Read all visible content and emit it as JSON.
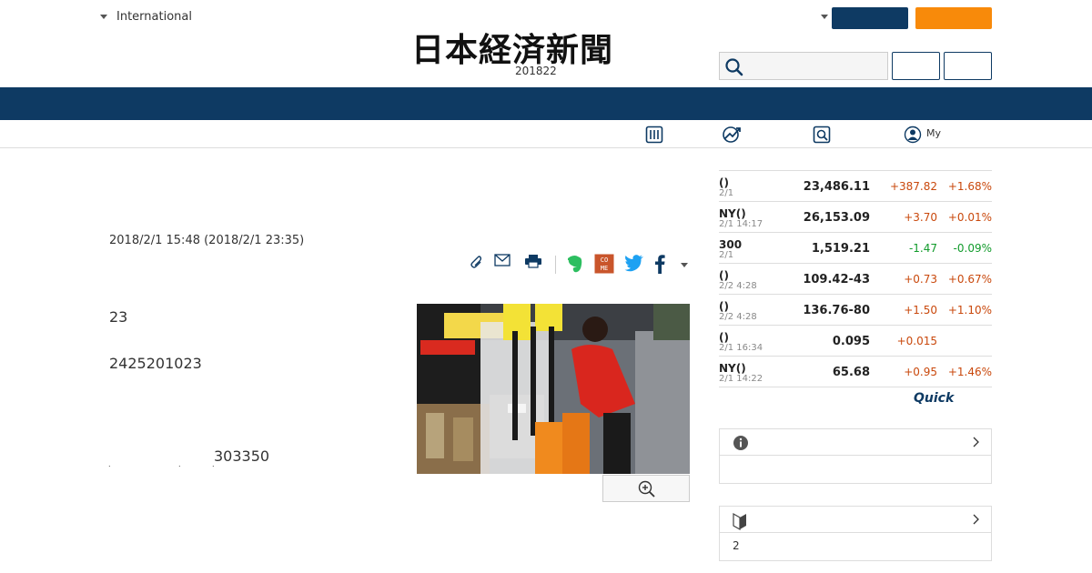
{
  "header": {
    "edition_label": "International",
    "logo_text": "日本経済新聞",
    "date_text": "201822",
    "search_placeholder": ""
  },
  "subnav": {
    "my_label": "My"
  },
  "article": {
    "timestamp": "2018/2/1 15:48 (2018/2/1 23:35)",
    "paragraphs": [
      "23",
      "2425201023",
      "303350"
    ]
  },
  "market": {
    "rows": [
      {
        "name": "()",
        "time": "2/1",
        "value": "23,486.11",
        "change": "+387.82",
        "pct": "+1.68%",
        "dir": "up"
      },
      {
        "name": "NY()",
        "time": "2/1 14:17",
        "value": "26,153.09",
        "change": "+3.70",
        "pct": "+0.01%",
        "dir": "up"
      },
      {
        "name": "300",
        "time": "2/1",
        "value": "1,519.21",
        "change": "-1.47",
        "pct": "-0.09%",
        "dir": "down"
      },
      {
        "name": "()",
        "time": "2/2 4:28",
        "value": "109.42-43",
        "change": "+0.73",
        "pct": "+0.67%",
        "dir": "up"
      },
      {
        "name": "()",
        "time": "2/2 4:28",
        "value": "136.76-80",
        "change": "+1.50",
        "pct": "+1.10%",
        "dir": "up"
      },
      {
        "name": "()",
        "time": "2/1 16:34",
        "value": "0.095",
        "change": "+0.015",
        "pct": "",
        "dir": "up"
      },
      {
        "name": "NY()",
        "time": "2/1 14:22",
        "value": "65.68",
        "change": "+0.95",
        "pct": "+1.46%",
        "dir": "up"
      }
    ],
    "source_logo": "Quick"
  },
  "panels": {
    "info_body": "",
    "beginner_body": "2"
  },
  "colors": {
    "navy": "#0e3a63",
    "orange": "#f88a0a",
    "up": "#c9480c",
    "down": "#119b2b"
  }
}
